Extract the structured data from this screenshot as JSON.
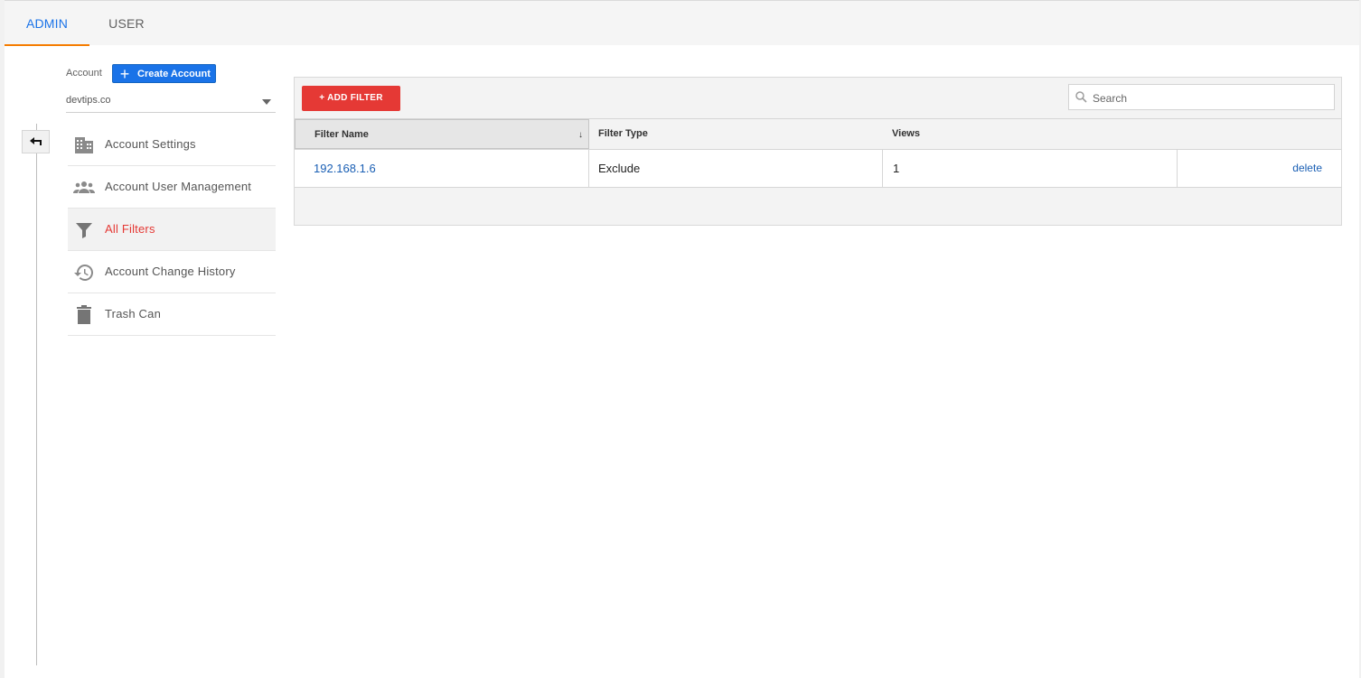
{
  "tabs": [
    {
      "label": "ADMIN",
      "active": true
    },
    {
      "label": "USER",
      "active": false
    }
  ],
  "account": {
    "label": "Account",
    "create_label": "Create Account",
    "selected": "devtips.co"
  },
  "nav": {
    "items": [
      {
        "label": "Account Settings",
        "icon": "building-icon"
      },
      {
        "label": "Account User Management",
        "icon": "people-icon"
      },
      {
        "label": "All Filters",
        "icon": "filter-icon",
        "active": true
      },
      {
        "label": "Account Change History",
        "icon": "history-icon"
      },
      {
        "label": "Trash Can",
        "icon": "trash-icon"
      }
    ]
  },
  "toolbar": {
    "add_label": "+ ADD FILTER",
    "search_placeholder": "Search"
  },
  "table": {
    "headers": [
      "Filter Name",
      "Filter Type",
      "Views"
    ],
    "sort_indicator": "↓",
    "rows": [
      {
        "name": "192.168.1.6",
        "type": "Exclude",
        "views": "1",
        "action": "delete"
      }
    ]
  },
  "colors": {
    "accent_blue": "#1a73e8",
    "active_red": "#e53935",
    "tab_underline": "#f57c00",
    "link_blue": "#1a5fb4"
  }
}
